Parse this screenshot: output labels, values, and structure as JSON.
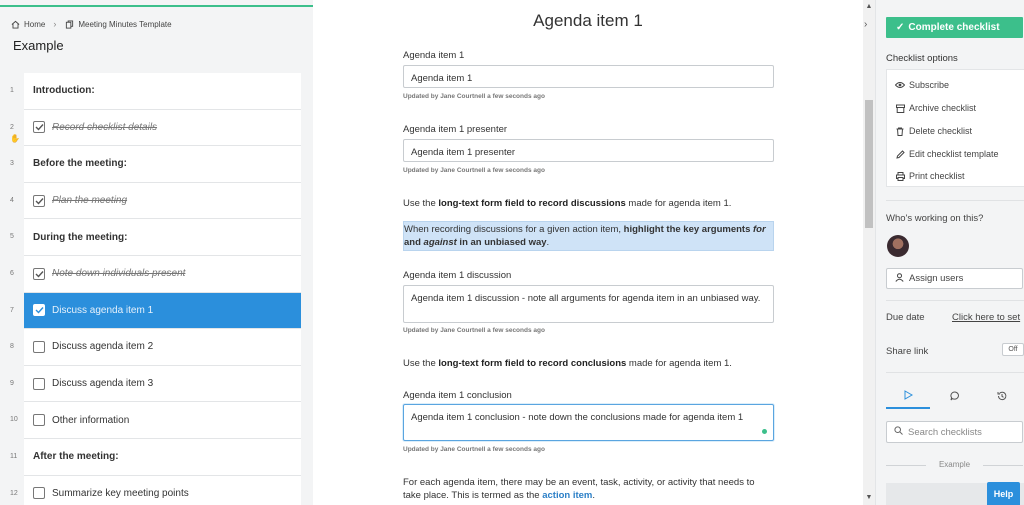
{
  "breadcrumb": {
    "home": "Home",
    "template": "Meeting Minutes Template"
  },
  "template_title": "Example",
  "tasks": [
    {
      "num": "1",
      "label": "Introduction:",
      "type": "heading"
    },
    {
      "num": "2",
      "label": "Record checklist details",
      "type": "done"
    },
    {
      "num": "3",
      "label": "Before the meeting:",
      "type": "heading"
    },
    {
      "num": "4",
      "label": "Plan the meeting",
      "type": "done"
    },
    {
      "num": "5",
      "label": "During the meeting:",
      "type": "heading"
    },
    {
      "num": "6",
      "label": "Note down individuals present",
      "type": "done"
    },
    {
      "num": "7",
      "label": "Discuss agenda item 1",
      "type": "active"
    },
    {
      "num": "8",
      "label": "Discuss agenda item 2",
      "type": "todo"
    },
    {
      "num": "9",
      "label": "Discuss agenda item 3",
      "type": "todo"
    },
    {
      "num": "10",
      "label": "Other information",
      "type": "todo"
    },
    {
      "num": "11",
      "label": "After the meeting:",
      "type": "heading"
    },
    {
      "num": "12",
      "label": "Summarize key meeting points",
      "type": "todo"
    }
  ],
  "main": {
    "title": "Agenda item 1",
    "field1_label": "Agenda item 1",
    "field1_value": "Agenda item 1",
    "updated": "Updated by Jane Courtnell a few seconds ago",
    "field2_label": "Agenda item 1 presenter",
    "field2_value": "Agenda item 1 presenter",
    "para1_pre": "Use the ",
    "para1_bold": "long-text form field to record discussions",
    "para1_post": " made for agenda item 1.",
    "hl_pre": "When recording discussions for a given action item, ",
    "hl_bold": "highlight the key arguments ",
    "hl_for": "for",
    "hl_and": " and ",
    "hl_against": "against",
    "hl_post": " in an unbiased way",
    "hl_end": ".",
    "field3_label": "Agenda item 1 discussion",
    "field3_value": "Agenda item 1 discussion - note all arguments for agenda item in an unbiased way.",
    "para2_pre": "Use the ",
    "para2_bold": "long-text form field to record conclusions",
    "para2_post": " made for agenda item 1.",
    "field4_label": "Agenda item 1 conclusion",
    "field4_value": "Agenda item 1 conclusion - note down the conclusions made for agenda item 1",
    "para3_text": "For each agenda item, there may be an event, task, activity, or activity that needs to take place. This is termed as the ",
    "para3_link": "action item",
    "para3_end": "."
  },
  "right": {
    "complete_label": "Complete checklist",
    "options_title": "Checklist options",
    "options": [
      "Subscribe",
      "Archive checklist",
      "Delete checklist",
      "Edit checklist template",
      "Print checklist"
    ],
    "who_title": "Who's working on this?",
    "assign_label": "Assign users",
    "due_label": "Due date",
    "due_link": "Click here to set",
    "share_label": "Share link",
    "share_toggle": "Off",
    "search_placeholder": "Search checklists",
    "example_sep": "Example",
    "help_label": "Help"
  },
  "colors": {
    "accent_green": "#3cbf8b",
    "accent_blue": "#2b8fdc",
    "highlight": "#cfe3f7"
  },
  "icons": [
    "home-icon",
    "template-icon",
    "check-icon",
    "eye-icon",
    "archive-icon",
    "trash-icon",
    "pencil-icon",
    "print-icon",
    "user-icon",
    "play-icon",
    "comment-icon",
    "history-icon",
    "search-icon",
    "chevron-right-icon"
  ]
}
